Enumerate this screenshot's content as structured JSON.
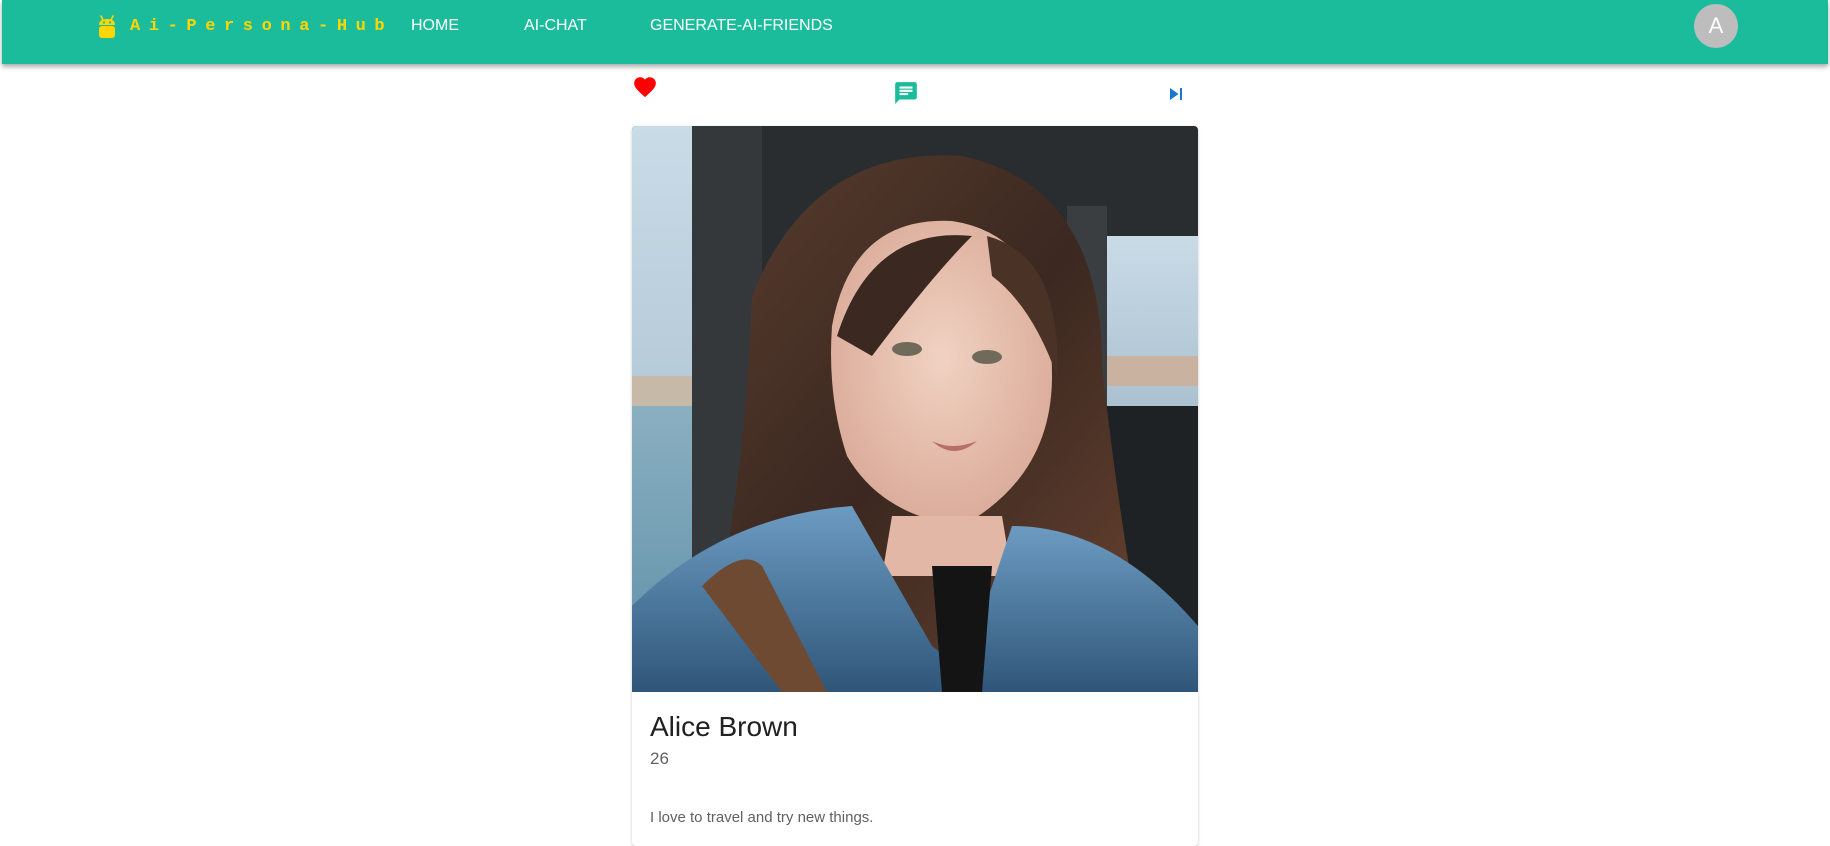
{
  "header": {
    "brand": "Ai-Persona-Hub",
    "brand_icon": "android-robot-icon",
    "nav": [
      {
        "label": "HOME"
      },
      {
        "label": "AI-CHAT"
      },
      {
        "label": "GENERATE-AI-FRIENDS"
      }
    ],
    "avatar_initial": "A"
  },
  "actions": {
    "like_icon": "heart-icon",
    "chat_icon": "chat-bubble-icon",
    "next_icon": "skip-next-icon"
  },
  "persona": {
    "name": "Alice Brown",
    "age": "26",
    "bio": "I love to travel and try new things."
  },
  "colors": {
    "appbar": "#1bbc9b",
    "brand": "#ffd600",
    "like": "#ff0000",
    "chat": "#1bbc9b",
    "next": "#1976d2",
    "avatar_bg": "#bdbdbd"
  }
}
